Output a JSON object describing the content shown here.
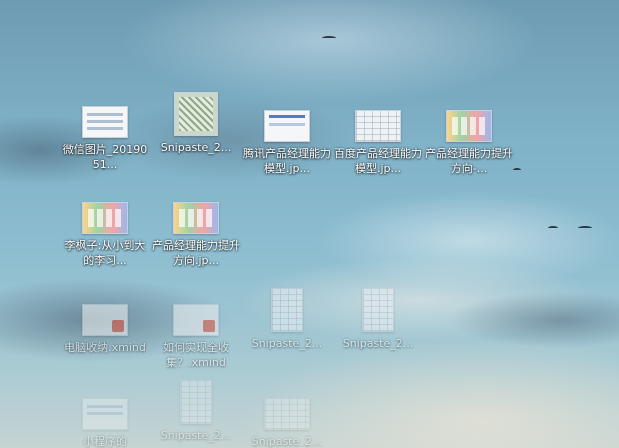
{
  "desktop": {
    "icons": [
      {
        "label": "微信图片_2019051...",
        "icon": "image-file-icon"
      },
      {
        "label": "Snipaste_2...",
        "icon": "image-file-icon"
      },
      {
        "label": "腾讯产品经理能力模型.jp...",
        "icon": "image-file-icon"
      },
      {
        "label": "百度产品经理能力模型.jp...",
        "icon": "image-file-icon"
      },
      {
        "label": "产品经理能力提升方向-...",
        "icon": "image-file-icon"
      },
      {
        "label": "李枫子:从小到大的李习...",
        "icon": "image-file-icon"
      },
      {
        "label": "产品经理能力提升方向.jp...",
        "icon": "image-file-icon"
      },
      {
        "label": "电脑收纳.xmind",
        "icon": "xmind-file-icon"
      },
      {
        "label": "如何实现全收集？.xmind",
        "icon": "xmind-file-icon"
      },
      {
        "label": "Snipaste_2...",
        "icon": "image-file-icon"
      },
      {
        "label": "Snipaste_2...",
        "icon": "image-file-icon"
      },
      {
        "label": "小程序的",
        "icon": "image-file-icon"
      },
      {
        "label": "Snipaste_2...",
        "icon": "image-file-icon"
      },
      {
        "label": "Snipaste_2...",
        "icon": "image-file-icon"
      }
    ]
  }
}
